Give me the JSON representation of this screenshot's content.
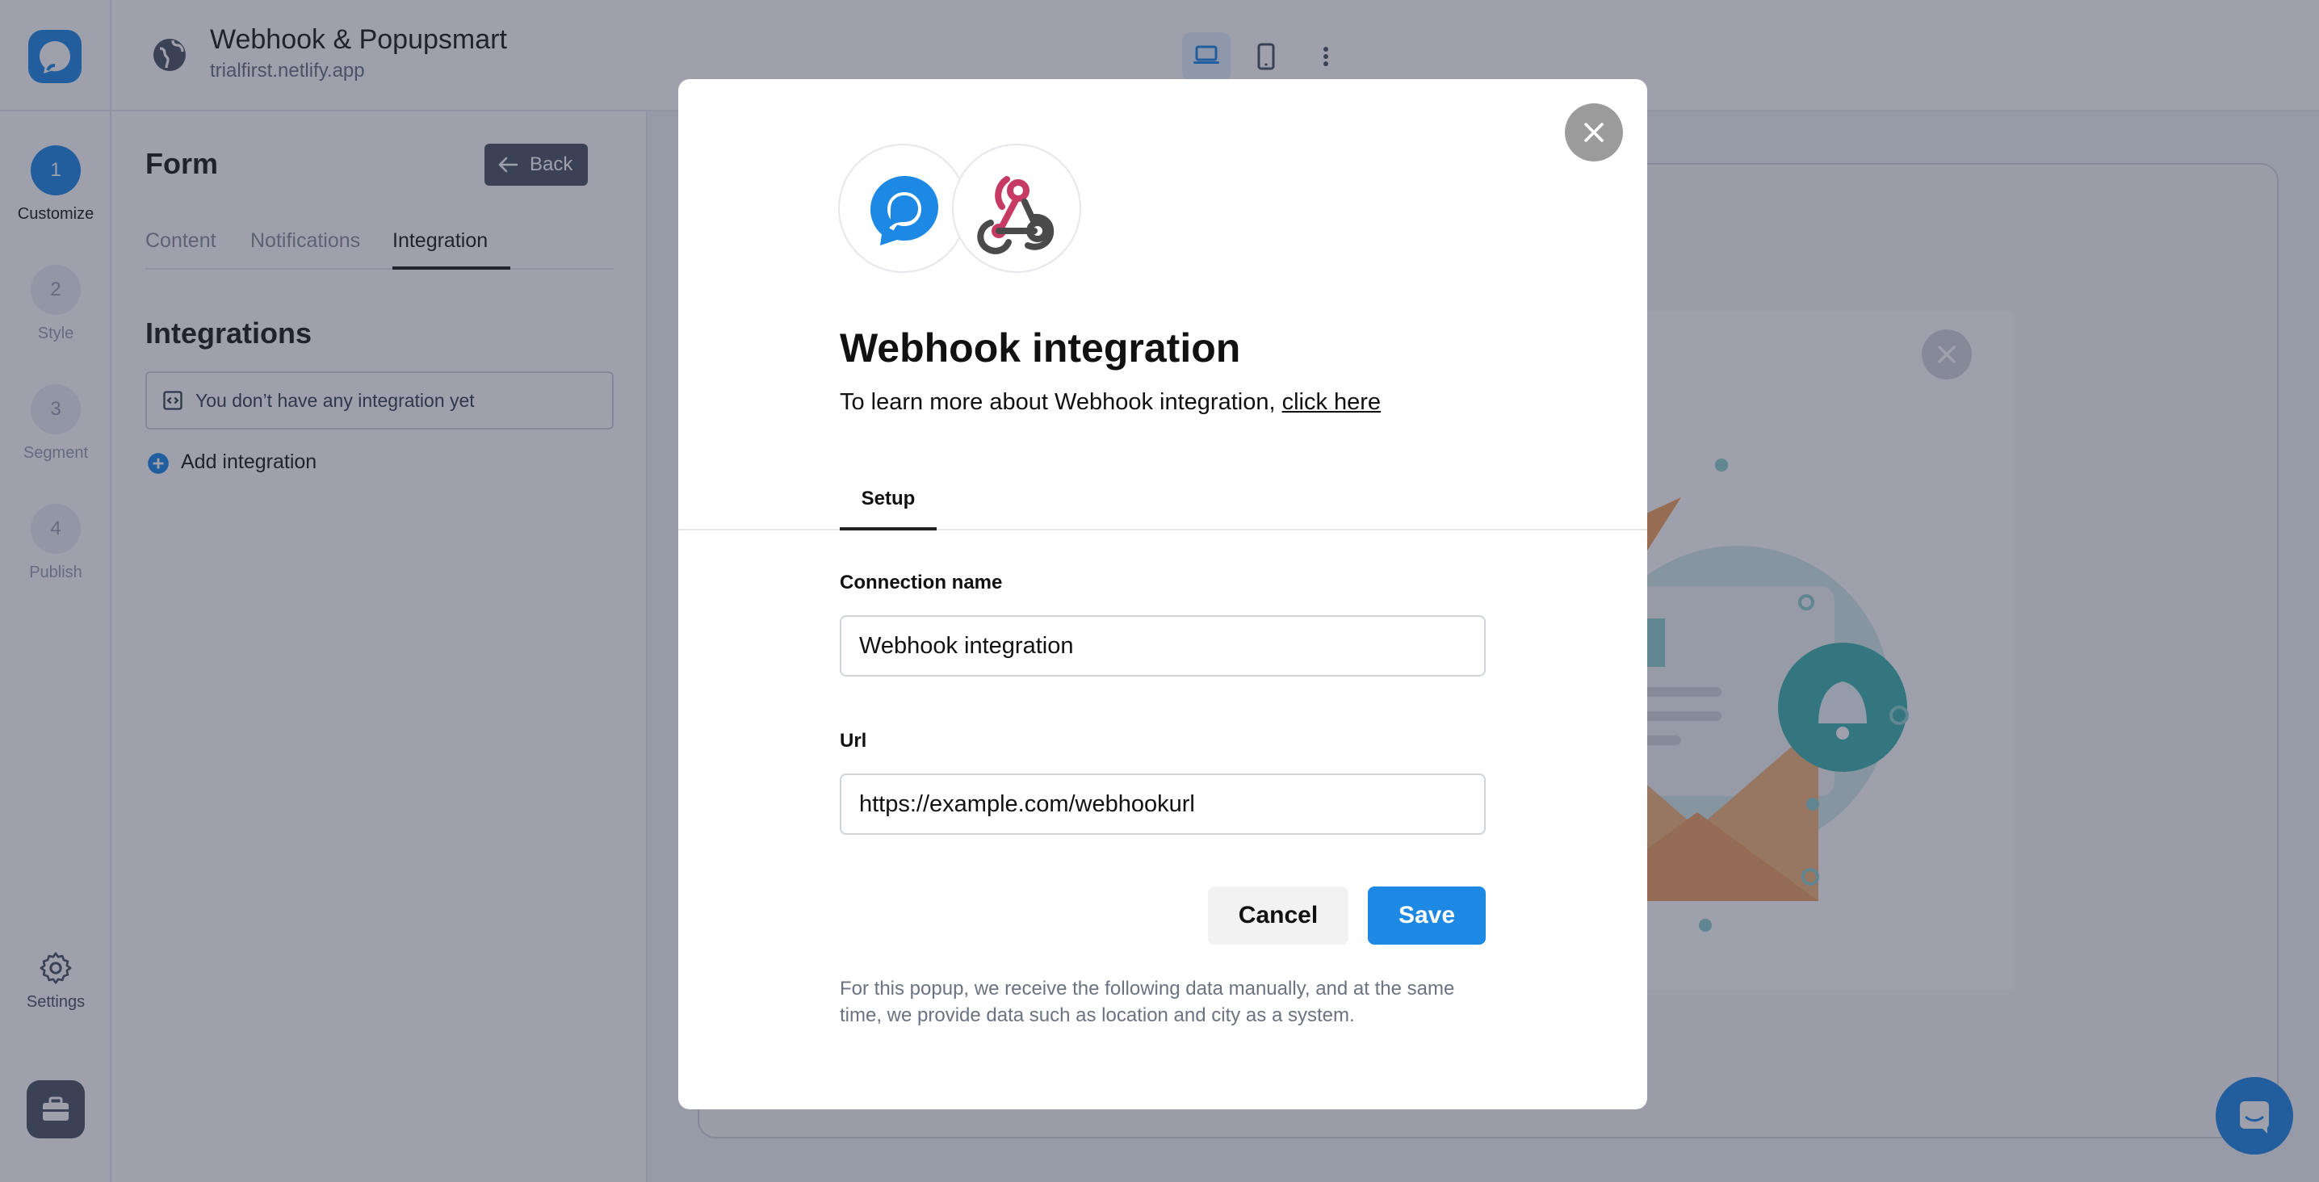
{
  "app": {
    "site_title": "Webhook & Popupsmart",
    "site_url": "trialfirst.netlify.app"
  },
  "steps": [
    {
      "number": "1",
      "label": "Customize"
    },
    {
      "number": "2",
      "label": "Style"
    },
    {
      "number": "3",
      "label": "Segment"
    },
    {
      "number": "4",
      "label": "Publish"
    }
  ],
  "settings_label": "Settings",
  "panel": {
    "title": "Form",
    "back_label": "Back",
    "tabs": [
      "Content",
      "Notifications",
      "Integration"
    ],
    "active_tab": "Integration",
    "integrations_heading": "Integrations",
    "empty_message": "You don’t have any integration yet",
    "add_integration_label": "Add integration"
  },
  "modal": {
    "title": "Webhook integration",
    "subtitle_prefix": "To learn more about Webhook integration, ",
    "subtitle_link": "click here",
    "tab_setup": "Setup",
    "connection_name_label": "Connection name",
    "connection_name_value": "Webhook integration",
    "url_label": "Url",
    "url_value": "https://example.com/webhookurl",
    "cancel_label": "Cancel",
    "save_label": "Save",
    "footnote": "For this popup, we receive the following data manually, and at the same time, we provide data such as location and city as a system."
  },
  "colors": {
    "accent": "#1e88e5",
    "webhook_red": "#c73a63",
    "webhook_dark": "#4a4a4a",
    "overlay": "rgba(40,44,70,0.45)"
  },
  "icons": {
    "close": "close-icon",
    "back": "arrow-left-icon",
    "globe": "globe-icon",
    "laptop": "laptop-icon",
    "phone": "phone-icon",
    "more": "more-vertical-icon",
    "settings": "gear-icon",
    "briefcase": "briefcase-icon",
    "add": "plus-circle-icon",
    "code": "code-icon",
    "chat": "chat-icon"
  }
}
